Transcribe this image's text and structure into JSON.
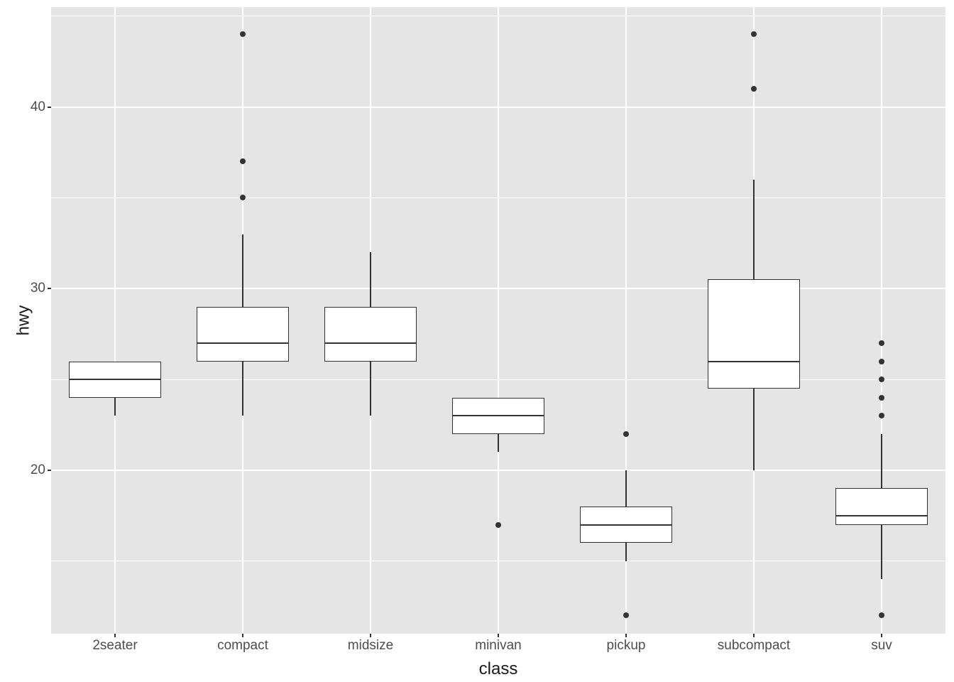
{
  "axis_labels": {
    "x": "class",
    "y": "hwy"
  },
  "y_ticks": [
    20,
    30,
    40
  ],
  "categories": [
    "2seater",
    "compact",
    "midsize",
    "minivan",
    "pickup",
    "subcompact",
    "suv"
  ],
  "chart_data": {
    "type": "box",
    "title": "",
    "xlabel": "class",
    "ylabel": "hwy",
    "ylim": [
      11,
      45.5
    ],
    "categories": [
      "2seater",
      "compact",
      "midsize",
      "minivan",
      "pickup",
      "subcompact",
      "suv"
    ],
    "series": [
      {
        "name": "2seater",
        "lower_whisker": 23,
        "q1": 24,
        "median": 25,
        "q3": 26,
        "upper_whisker": 26,
        "outliers": []
      },
      {
        "name": "compact",
        "lower_whisker": 23,
        "q1": 26,
        "median": 27,
        "q3": 29,
        "upper_whisker": 33,
        "outliers": [
          35,
          37,
          44
        ]
      },
      {
        "name": "midsize",
        "lower_whisker": 23,
        "q1": 26,
        "median": 27,
        "q3": 29,
        "upper_whisker": 32,
        "outliers": []
      },
      {
        "name": "minivan",
        "lower_whisker": 21,
        "q1": 22,
        "median": 23,
        "q3": 24,
        "upper_whisker": 24,
        "outliers": [
          17
        ]
      },
      {
        "name": "pickup",
        "lower_whisker": 15,
        "q1": 16,
        "median": 17,
        "q3": 18,
        "upper_whisker": 20,
        "outliers": [
          12,
          22
        ]
      },
      {
        "name": "subcompact",
        "lower_whisker": 20,
        "q1": 24.5,
        "median": 26,
        "q3": 30.5,
        "upper_whisker": 36,
        "outliers": [
          41,
          44
        ]
      },
      {
        "name": "suv",
        "lower_whisker": 14,
        "q1": 17,
        "median": 17.5,
        "q3": 19,
        "upper_whisker": 22,
        "outliers": [
          12,
          23,
          24,
          25,
          26,
          27
        ]
      }
    ]
  }
}
